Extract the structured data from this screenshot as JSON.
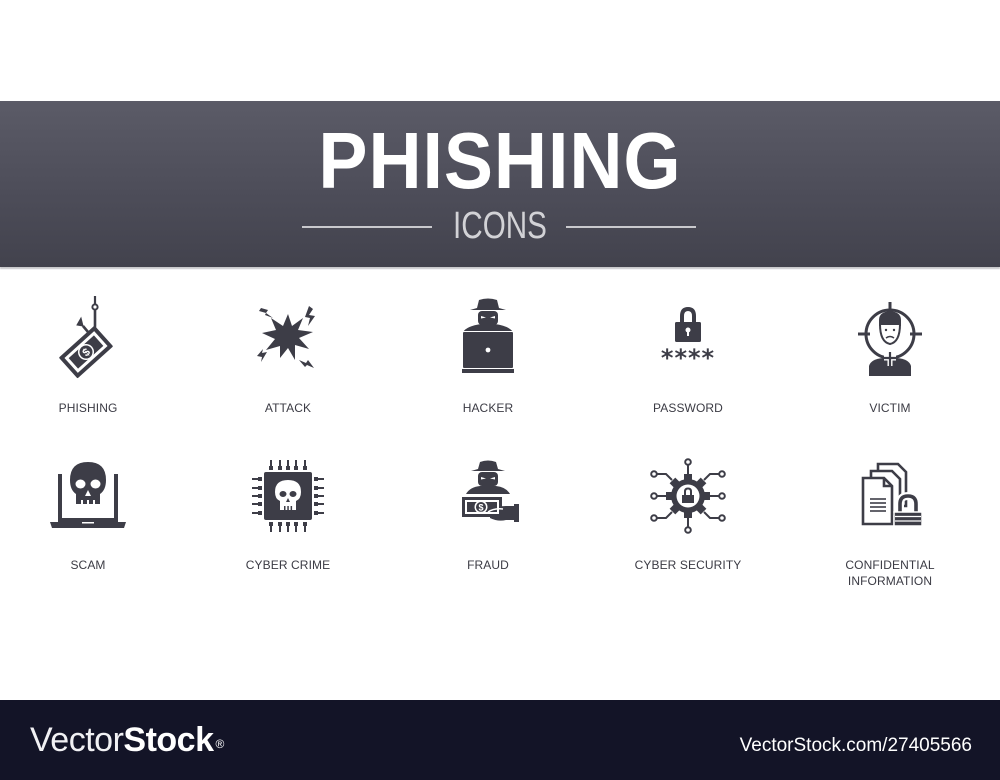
{
  "banner": {
    "title": "PHISHING",
    "subtitle": "ICONS"
  },
  "colors": {
    "banner_top": "#5b5b67",
    "banner_bottom": "#42424d",
    "icon_fill": "#3d3d47",
    "label_text": "#3b3b44",
    "footer_bg": "#131427"
  },
  "icons": [
    {
      "label": "PHISHING",
      "icon": "fishing-hook-money-icon"
    },
    {
      "label": "ATTACK",
      "icon": "explosion-icon"
    },
    {
      "label": "HACKER",
      "icon": "hacker-laptop-icon"
    },
    {
      "label": "PASSWORD",
      "icon": "padlock-password-icon"
    },
    {
      "label": "VICTIM",
      "icon": "target-person-icon"
    },
    {
      "label": "SCAM",
      "icon": "skull-laptop-icon"
    },
    {
      "label": "CYBER CRIME",
      "icon": "skull-chip-icon"
    },
    {
      "label": "FRAUD",
      "icon": "hacker-money-icon"
    },
    {
      "label": "CYBER SECURITY",
      "icon": "gear-lock-network-icon"
    },
    {
      "label": "CONFIDENTIAL",
      "label2": "INFORMATION",
      "icon": "documents-lock-icon"
    }
  ],
  "password_mask": "****",
  "footer": {
    "brand_thin": "Vector",
    "brand_bold": "Stock",
    "registered": "®",
    "url": "VectorStock.com/27405566"
  }
}
